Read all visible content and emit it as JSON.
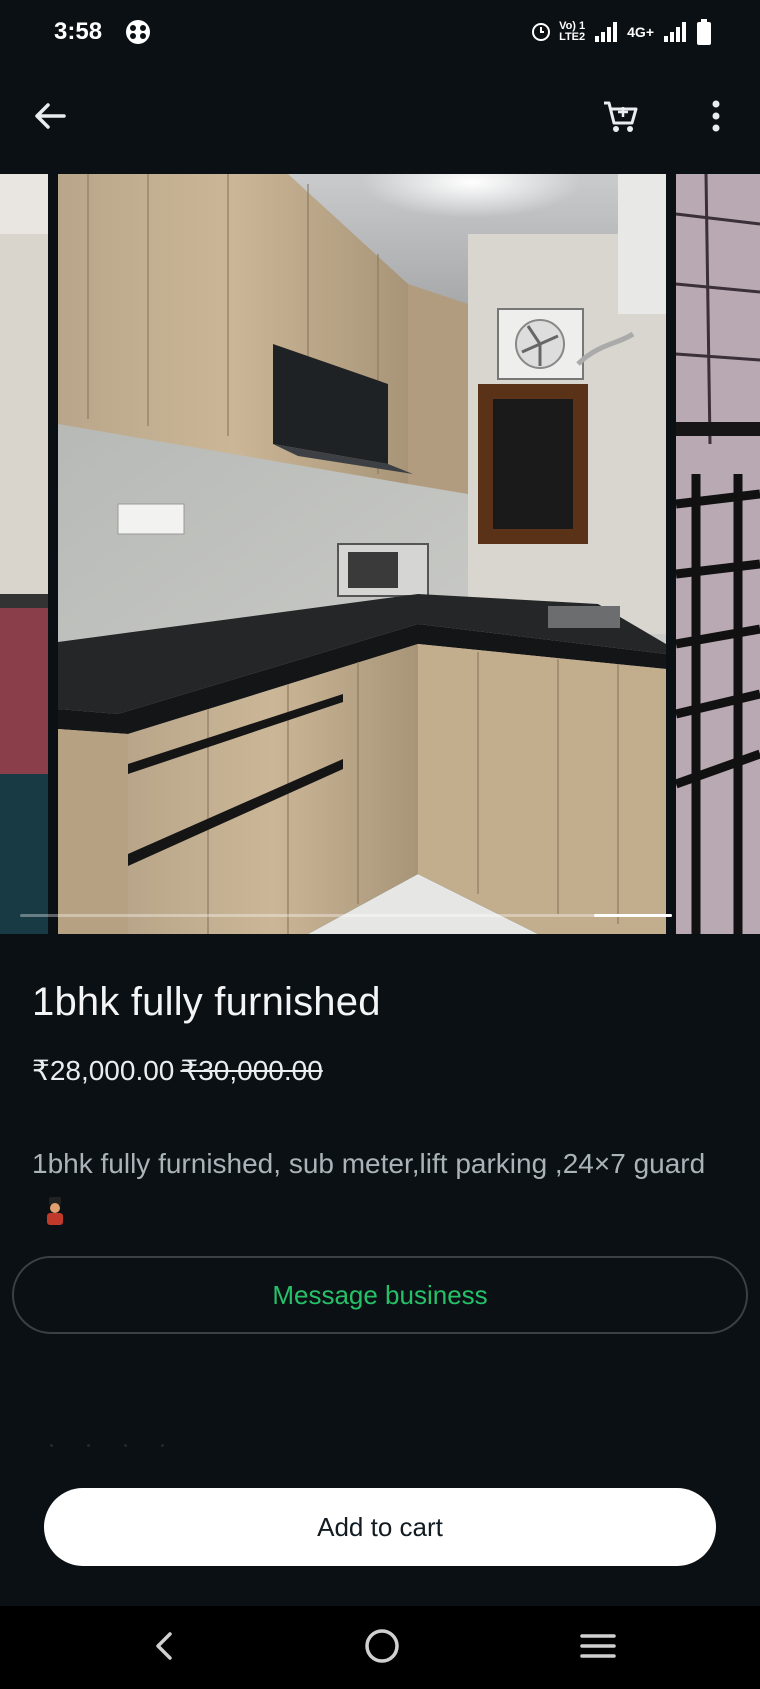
{
  "status_bar": {
    "time": "3:58",
    "volte_top": "Vo) 1",
    "volte_bottom": "LTE2",
    "network": "4G+"
  },
  "app_bar": {
    "icons": [
      "back-arrow-icon",
      "cart-icon",
      "more-vert-icon"
    ]
  },
  "product": {
    "title": "1bhk fully furnished",
    "price_current": "₹28,000.00",
    "price_original": "₹30,000.00",
    "description": "1bhk fully furnished,  sub meter,lift  parking ,24×7 guard"
  },
  "actions": {
    "message_business": "Message business",
    "add_to_cart": "Add to cart"
  },
  "colors": {
    "background": "#0b1014",
    "accent_green": "#25c068",
    "nav_bar": "#000000"
  }
}
